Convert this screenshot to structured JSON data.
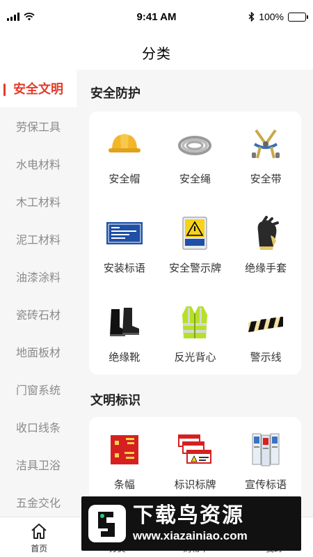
{
  "status_bar": {
    "time": "9:41 AM",
    "battery": "100%"
  },
  "header": {
    "title": "分类"
  },
  "sidebar": {
    "items": [
      {
        "label": "安全文明",
        "active": true
      },
      {
        "label": "劳保工具"
      },
      {
        "label": "水电材料"
      },
      {
        "label": "木工材料"
      },
      {
        "label": "泥工材料"
      },
      {
        "label": "油漆涂料"
      },
      {
        "label": "瓷砖石材"
      },
      {
        "label": "地面板材"
      },
      {
        "label": "门窗系统"
      },
      {
        "label": "收口线条"
      },
      {
        "label": "洁具卫浴"
      },
      {
        "label": "五金交化"
      }
    ]
  },
  "sections": [
    {
      "title": "安全防护",
      "items": [
        {
          "label": "安全帽",
          "icon": "helmet-icon"
        },
        {
          "label": "安全绳",
          "icon": "rope-icon"
        },
        {
          "label": "安全带",
          "icon": "harness-icon"
        },
        {
          "label": "安装标语",
          "icon": "slogan-sign-icon"
        },
        {
          "label": "安全警示牌",
          "icon": "warning-sign-icon"
        },
        {
          "label": "绝缘手套",
          "icon": "glove-icon"
        },
        {
          "label": "绝缘靴",
          "icon": "boots-icon"
        },
        {
          "label": "反光背心",
          "icon": "vest-icon"
        },
        {
          "label": "警示线",
          "icon": "tape-icon"
        }
      ]
    },
    {
      "title": "文明标识",
      "items": [
        {
          "label": "条幅",
          "icon": "banner-icon"
        },
        {
          "label": "标识标牌",
          "icon": "signboard-icon"
        },
        {
          "label": "宣传标语",
          "icon": "poster-icon"
        }
      ]
    }
  ],
  "tabbar": {
    "items": [
      {
        "label": "首页",
        "icon": "home-icon"
      },
      {
        "label": "分类",
        "icon": "category-icon"
      },
      {
        "label": "购物车",
        "icon": "cart-icon"
      },
      {
        "label": "我的",
        "icon": "user-icon"
      }
    ]
  },
  "watermark": {
    "cn": "下载鸟资源",
    "url": "www.xiazainiao.com"
  },
  "colors": {
    "accent": "#e53a2a",
    "sidebar_bg": "#f6f6f6",
    "card_bg": "#ffffff"
  }
}
